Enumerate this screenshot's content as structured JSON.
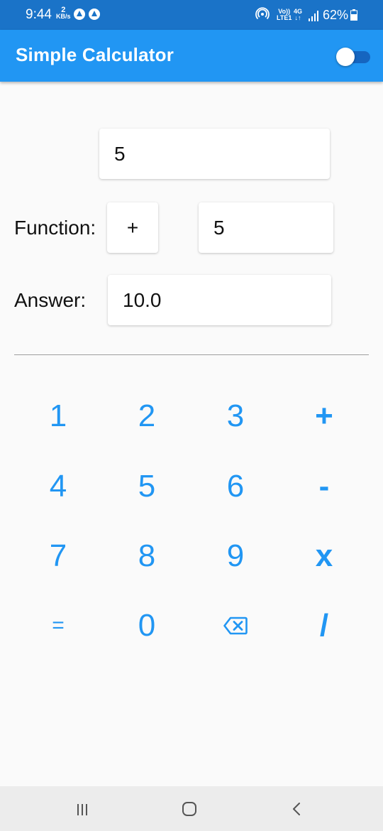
{
  "status_bar": {
    "time": "9:44",
    "speed_value": "2",
    "speed_unit": "KB/s",
    "volte_top": "Vo))",
    "volte_bottom": "LTE1",
    "network_top": "4G",
    "network_bottom": "↓↑",
    "battery": "62%"
  },
  "app_bar": {
    "title": "Simple Calculator",
    "theme_toggle_on": false
  },
  "calculator": {
    "first_number": "5",
    "function_label": "Function:",
    "operator": "+",
    "second_number": "5",
    "answer_label": "Answer:",
    "answer": "10.0"
  },
  "keypad": {
    "keys": [
      "1",
      "2",
      "3",
      "+",
      "4",
      "5",
      "6",
      "-",
      "7",
      "8",
      "9",
      "x",
      "=",
      "0",
      "backspace",
      "/"
    ]
  },
  "colors": {
    "primary": "#2196f3",
    "status_bar": "#1a73c8",
    "background": "#fafafa"
  }
}
